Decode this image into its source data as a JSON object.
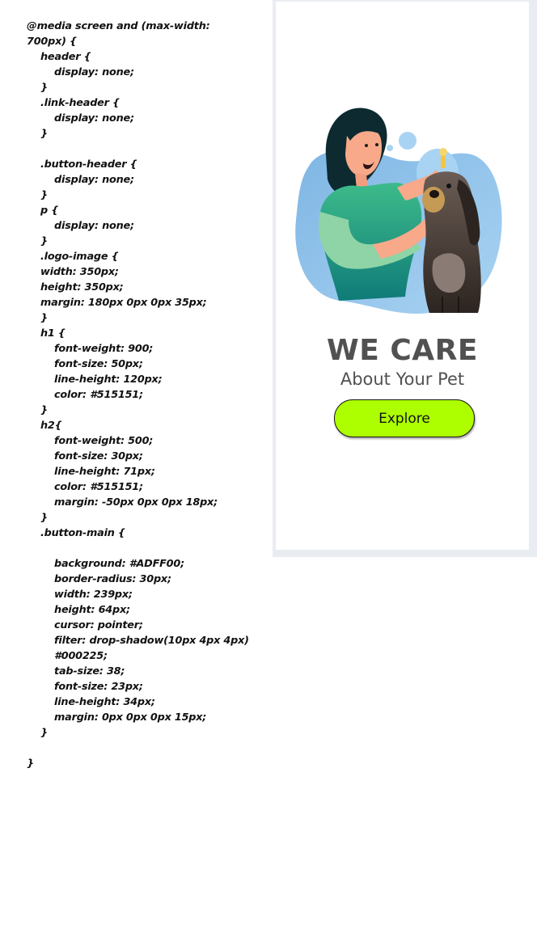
{
  "code": {
    "text": "@media screen and (max-width:\n700px) {\n    header {\n        display: none;\n    }\n    .link-header {\n        display: none;\n    }\n\n    .button-header {\n        display: none;\n    }\n    p {\n        display: none;\n    }\n    .logo-image {\n    width: 350px;\n    height: 350px;\n    margin: 180px 0px 0px 35px;\n    }\n    h1 {\n        font-weight: 900;\n        font-size: 50px;\n        line-height: 120px;\n        color: #515151;\n    }\n    h2{\n        font-weight: 500;\n        font-size: 30px;\n        line-height: 71px;\n        color: #515151;\n        margin: -50px 0px 0px 18px;\n    }\n    .button-main {\n\n        background: #ADFF00;\n        border-radius: 30px;\n        width: 239px;\n        height: 64px;\n        cursor: pointer;\n        filter: drop-shadow(10px 4px 4px)\n        #000225;\n        tab-size: 38;\n        font-size: 23px;\n        line-height: 34px;\n        margin: 0px 0px 0px 15px;\n    }\n\n}"
  },
  "preview": {
    "title": "WE CARE",
    "subtitle": "About Your Pet",
    "button_label": "Explore",
    "illustration_icon": "woman-with-dog-illustration"
  },
  "colors": {
    "title_text": "#515151",
    "button_bg": "#ADFF00",
    "blob_blue": "#8fc3ea",
    "shirt_green": "#2ea37f"
  }
}
